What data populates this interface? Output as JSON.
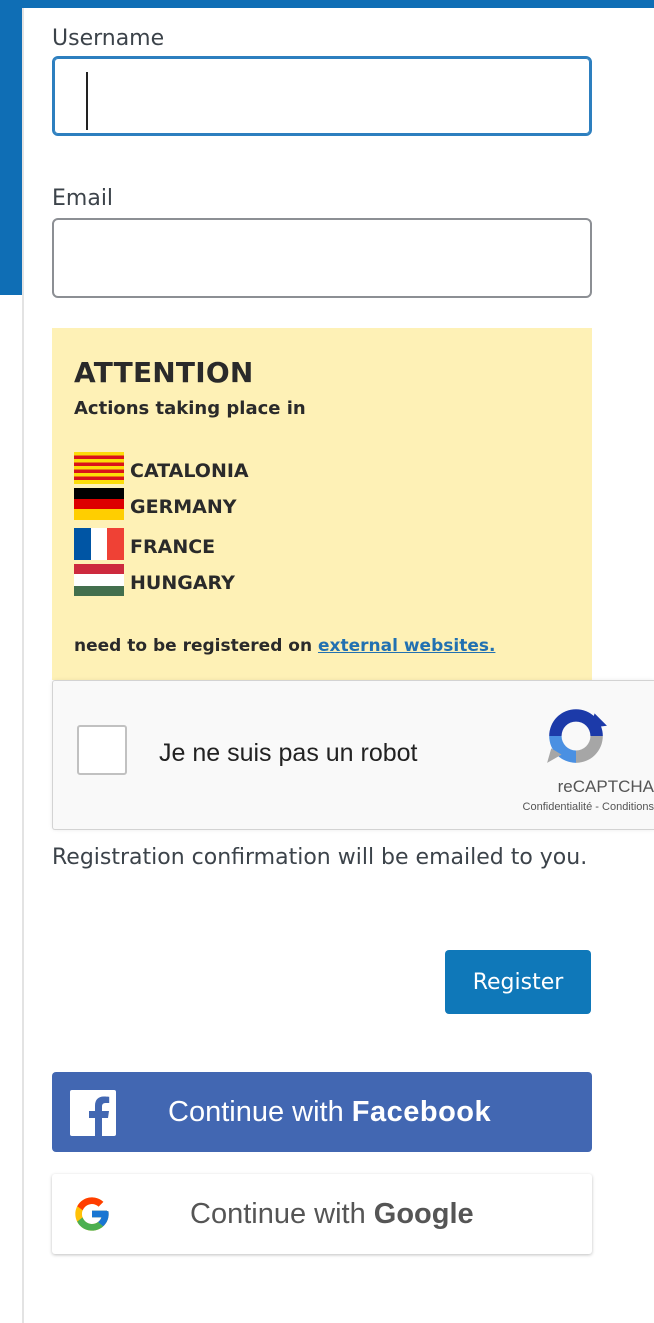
{
  "form": {
    "username_label": "Username",
    "username_value": "",
    "email_label": "Email",
    "email_value": ""
  },
  "attention": {
    "title": "ATTENTION",
    "subtitle": "Actions taking place in",
    "countries": [
      {
        "name": "CATALONIA",
        "flag": "catalonia-flag"
      },
      {
        "name": "GERMANY",
        "flag": "germany-flag"
      },
      {
        "name": "FRANCE",
        "flag": "france-flag"
      },
      {
        "name": "HUNGARY",
        "flag": "hungary-flag"
      }
    ],
    "note_prefix": "need to be registered on",
    "note_link": "external websites."
  },
  "recaptcha": {
    "label": "Je ne suis pas un robot",
    "brand": "reCAPTCHA",
    "privacy": "Confidentialité",
    "separator": " - ",
    "terms": "Conditions"
  },
  "confirmation_text": "Registration confirmation will be emailed to you.",
  "register_label": "Register",
  "social": {
    "facebook_prefix": "Continue with ",
    "facebook_brand": "Facebook",
    "google_prefix": "Continue with ",
    "google_brand": "Google"
  },
  "colors": {
    "primary": "#0f78b9",
    "facebook": "#4267b2",
    "attention_bg": "#fef1b6",
    "focus_border": "#2d7fbf"
  }
}
